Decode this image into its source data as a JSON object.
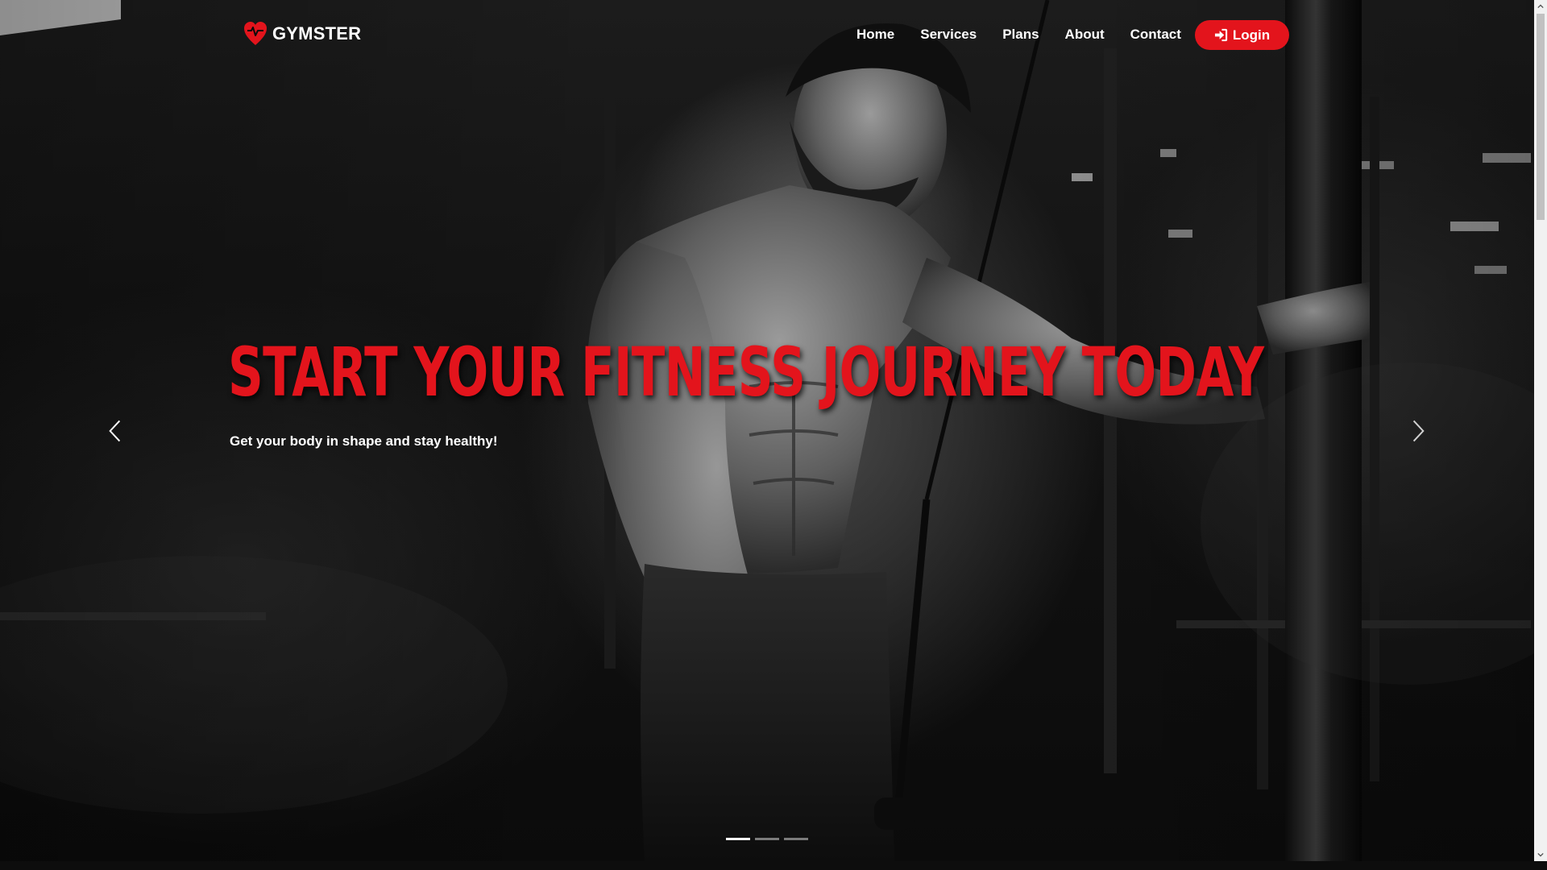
{
  "brand": {
    "name": "GYMSTER",
    "logo_icon": "heart-pulse-icon",
    "accent_color": "#e3141c"
  },
  "nav": {
    "links": [
      {
        "label": "Home"
      },
      {
        "label": "Services"
      },
      {
        "label": "Plans"
      },
      {
        "label": "About"
      },
      {
        "label": "Contact"
      }
    ],
    "login": {
      "label": "Login",
      "icon": "sign-in-icon"
    }
  },
  "hero": {
    "title": "START YOUR FITNESS JOURNEY TODAY",
    "subtitle": "Get your body in shape and stay healthy!",
    "title_color": "#e3141c",
    "prev_icon": "chevron-left-icon",
    "next_icon": "chevron-right-icon",
    "slides_total": 3,
    "active_slide": 1
  }
}
